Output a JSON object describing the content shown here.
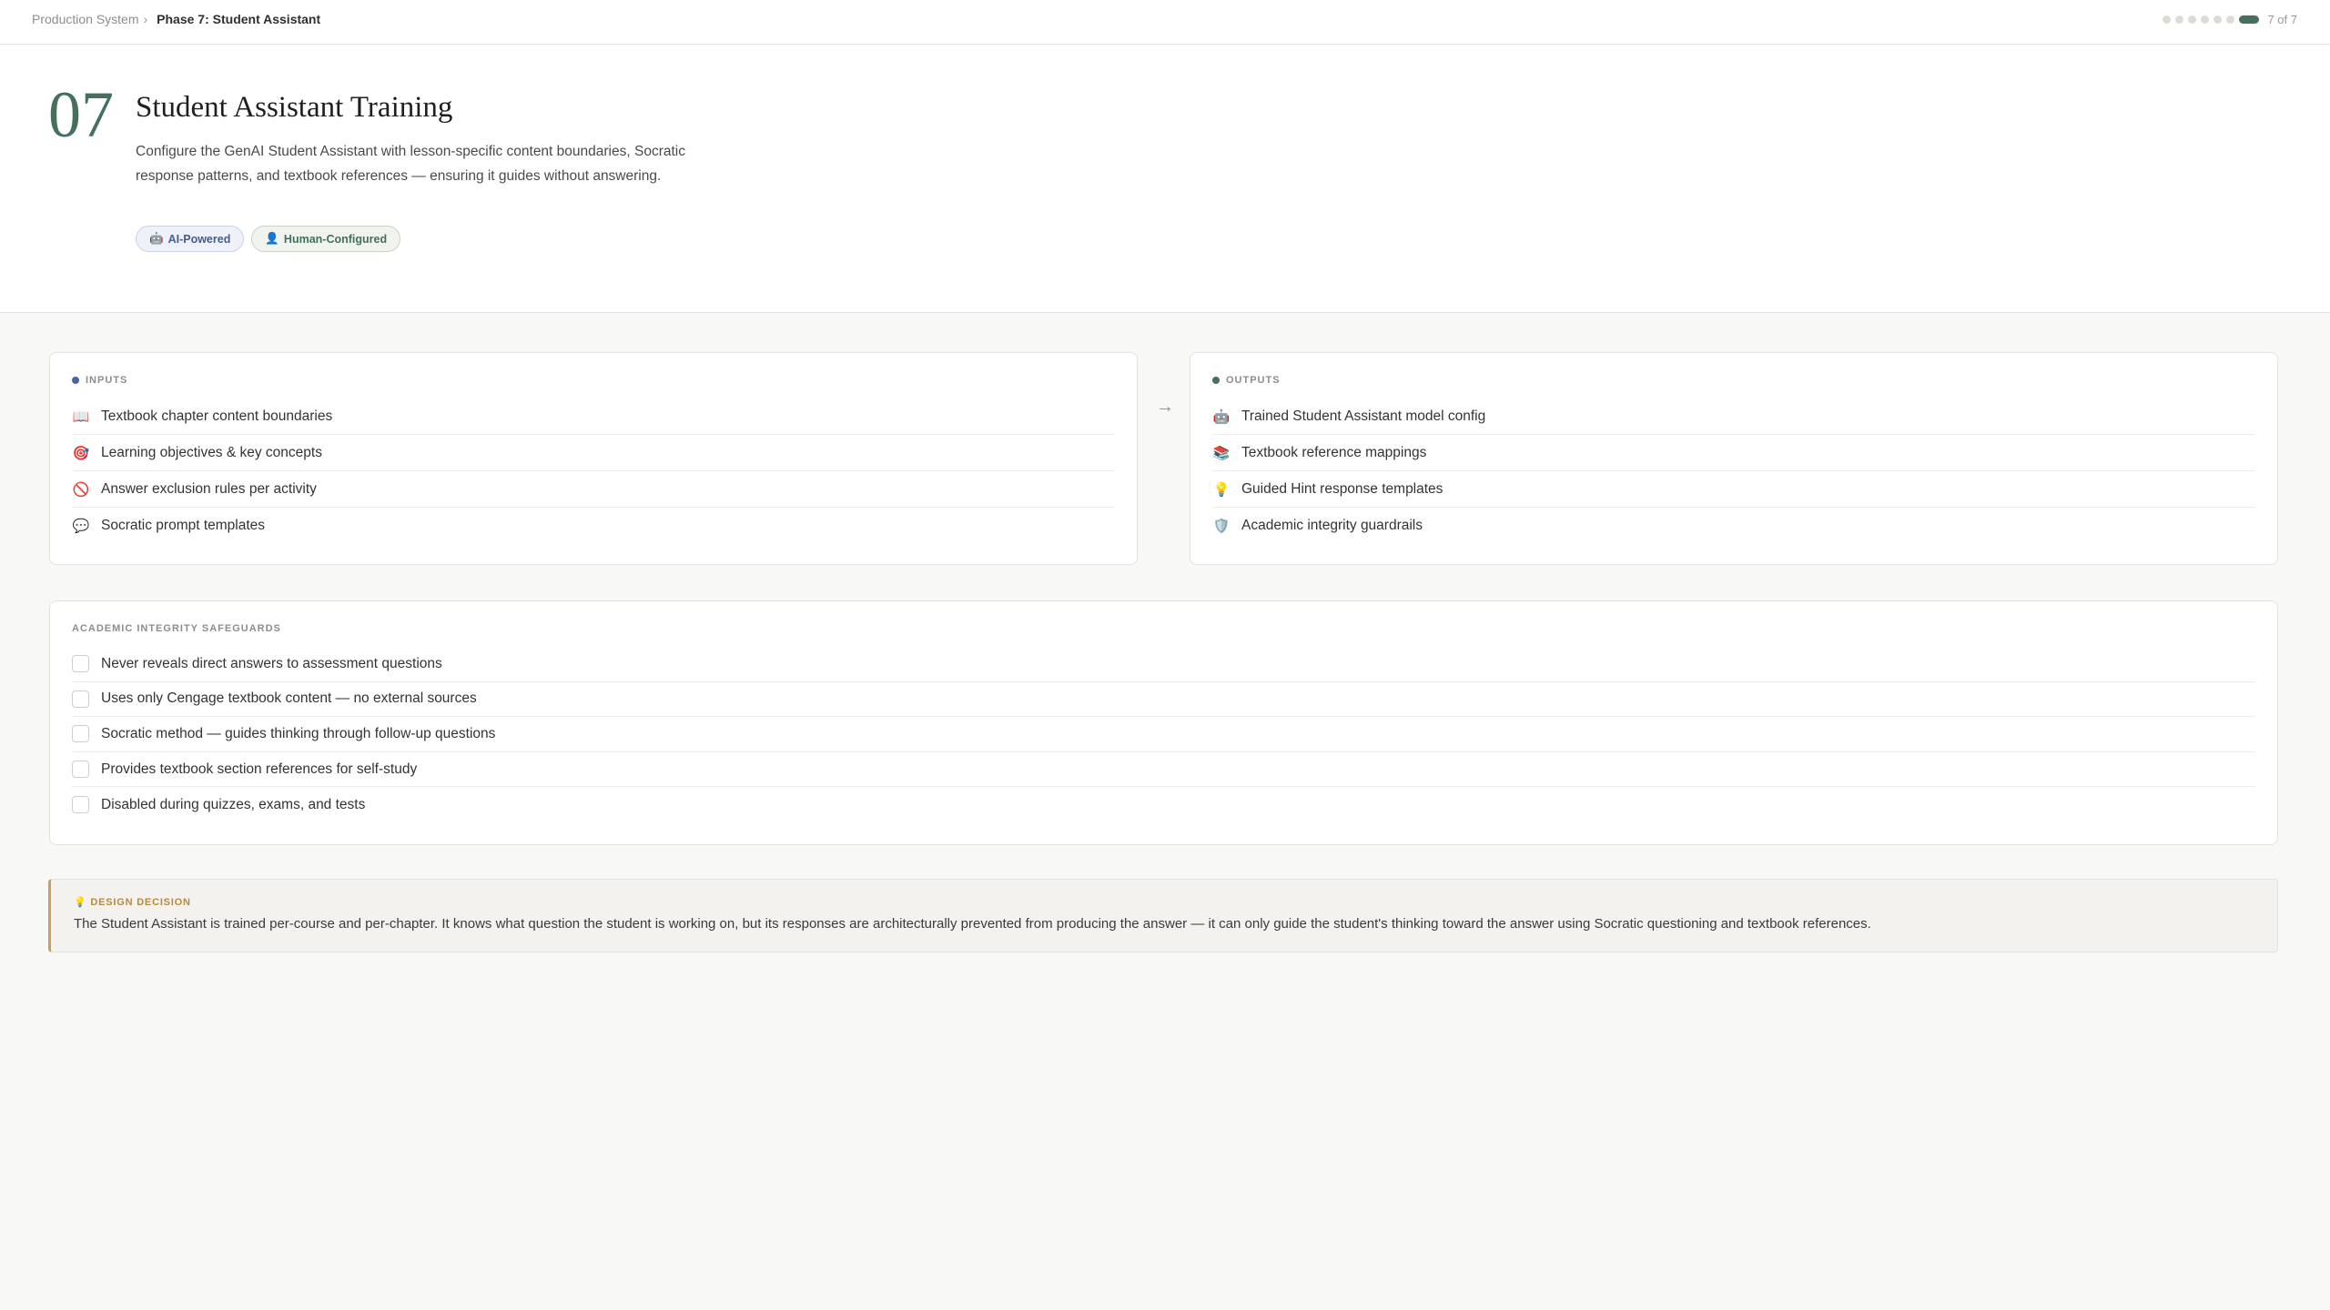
{
  "breadcrumb": {
    "parent": "Production System",
    "separator": "›",
    "current": "Phase 7: Student Assistant"
  },
  "progress": {
    "total_steps": 7,
    "current_step": 7,
    "label": "7 of 7",
    "active_color": "#44705d"
  },
  "hero": {
    "number": "07",
    "title": "Student Assistant Training",
    "description": "Configure the GenAI Student Assistant with lesson-specific content boundaries, Socratic response patterns, and textbook references — ensuring it guides without answering.",
    "badges": [
      {
        "icon": "🤖",
        "label": "AI-Powered"
      },
      {
        "icon": "👤",
        "label": "Human-Configured"
      }
    ]
  },
  "inputs": {
    "label": "INPUTS",
    "bullet_color": "#4b63a3",
    "items": [
      {
        "icon": "📖",
        "icon_name": "book-icon",
        "label": "Textbook chapter content boundaries"
      },
      {
        "icon": "🎯",
        "icon_name": "target-icon",
        "label": "Learning objectives & key concepts"
      },
      {
        "icon": "🚫",
        "icon_name": "prohibited-icon",
        "label": "Answer exclusion rules per activity"
      },
      {
        "icon": "💬",
        "icon_name": "speech-bubble-icon",
        "label": "Socratic prompt templates"
      }
    ]
  },
  "arrow": "→",
  "outputs": {
    "label": "OUTPUTS",
    "bullet_color": "#44705d",
    "items": [
      {
        "icon": "🤖",
        "icon_name": "robot-icon",
        "label": "Trained Student Assistant model config"
      },
      {
        "icon": "📚",
        "icon_name": "books-icon",
        "label": "Textbook reference mappings"
      },
      {
        "icon": "💡",
        "icon_name": "lightbulb-icon",
        "label": "Guided Hint response templates"
      },
      {
        "icon": "🛡️",
        "icon_name": "shield-icon",
        "label": "Academic integrity guardrails"
      }
    ]
  },
  "safeguards": {
    "label": "ACADEMIC INTEGRITY SAFEGUARDS",
    "items": [
      {
        "label": "Never reveals direct answers to assessment questions",
        "checked": false
      },
      {
        "label": "Uses only Cengage textbook content — no external sources",
        "checked": false
      },
      {
        "label": "Socratic method — guides thinking through follow-up questions",
        "checked": false
      },
      {
        "label": "Provides textbook section references for self-study",
        "checked": false
      },
      {
        "label": "Disabled during quizzes, exams, and tests",
        "checked": false
      }
    ]
  },
  "decision": {
    "icon": "💡",
    "label": "DESIGN DECISION",
    "text": "The Student Assistant is trained per-course and per-chapter. It knows what question the student is working on, but its responses are architecturally prevented from producing the answer — it can only guide the student's thinking toward the answer using Socratic questioning and textbook references.",
    "accent_color": "#c8a25a"
  }
}
